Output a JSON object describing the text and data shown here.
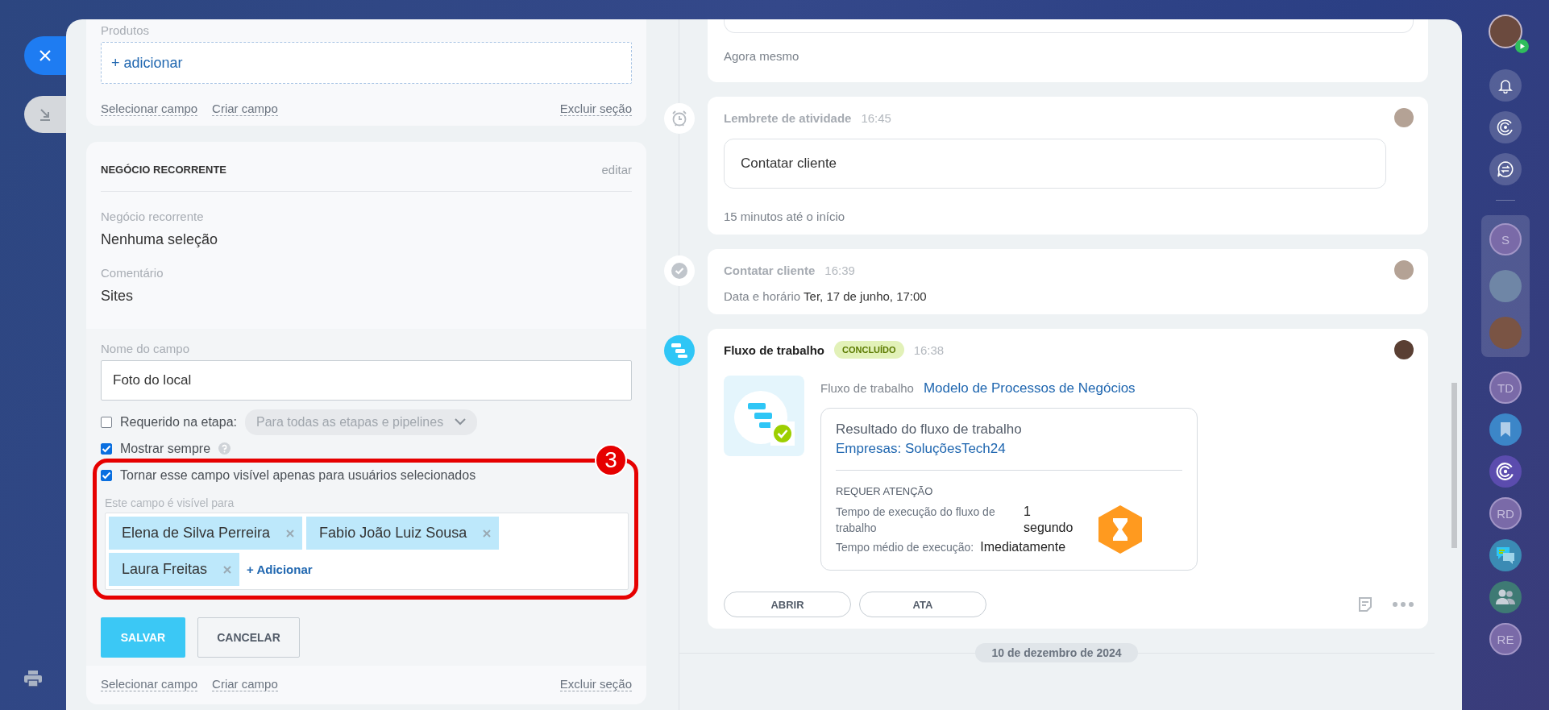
{
  "left_panel": {
    "products_section": {
      "label": "Produtos",
      "add_link": "+ adicionar",
      "links": [
        "Selecionar campo",
        "Criar campo"
      ],
      "delete_link": "Excluir seção"
    },
    "recurring_section": {
      "title": "NEGÓCIO RECORRENTE",
      "edit_link": "editar",
      "fields": [
        {
          "label": "Negócio recorrente",
          "value": "Nenhuma seleção"
        },
        {
          "label": "Comentário",
          "value": "Sites"
        }
      ],
      "editor": {
        "name_label": "Nome do campo",
        "name_value": "Foto do local",
        "options": [
          {
            "kind": "dropdown",
            "label": "Requerido na etapa:",
            "checked": false,
            "dropdown": "Para todas as etapas e pipelines"
          },
          {
            "kind": "help",
            "label": "Mostrar sempre",
            "checked": true
          },
          {
            "kind": "plain",
            "label": "Tornar esse campo visível apenas para usuários selecionados",
            "checked": true
          }
        ],
        "callout": "3",
        "visible_for": {
          "label": "Este campo é visível para",
          "users": [
            "Elena de Silva Perreira",
            "Fabio João Luiz Sousa",
            "Laura Freitas"
          ],
          "add_link": "+ Adicionar"
        },
        "save": "SALVAR",
        "cancel": "CANCELAR"
      },
      "links": [
        "Selecionar campo",
        "Criar campo"
      ],
      "delete_link": "Excluir seção"
    }
  },
  "timeline": {
    "events": [
      {
        "kind": "note",
        "footer": "Agora mesmo"
      },
      {
        "kind": "reminder",
        "title": "Lembrete de atividade",
        "time": "16:45",
        "body": "Contatar cliente",
        "footer": "15 minutos até o início"
      },
      {
        "kind": "done",
        "title": "Contatar cliente",
        "time": "16:39",
        "detail_label": "Data e horário",
        "detail_value": "Ter, 17 de junho, 17:00"
      },
      {
        "kind": "workflow",
        "title": "Fluxo de trabalho",
        "status": "CONCLUÍDO",
        "time": "16:38",
        "link_label": "Fluxo de trabalho",
        "link": "Modelo de Processos de Negócios",
        "result_title": "Resultado do fluxo de trabalho",
        "result_link": "Empresas: SoluçõesTech24",
        "attention": "REQUER ATENÇÃO",
        "stats": [
          {
            "label": "Tempo de execução do fluxo de trabalho",
            "value": "1 segundo"
          },
          {
            "label": "Tempo médio de execução:",
            "value": "Imediatamente"
          }
        ],
        "buttons": [
          "ABRIR",
          "ATA"
        ]
      }
    ],
    "date_divider": "10 de dezembro de 2024"
  },
  "sidebar": {
    "tools": [
      {
        "kind": "bell"
      },
      {
        "kind": "swirl"
      },
      {
        "kind": "swap-chat"
      }
    ],
    "pinned": [
      {
        "kind": "initials",
        "text": "S"
      },
      {
        "kind": "photo"
      },
      {
        "kind": "photo"
      }
    ],
    "items": [
      {
        "kind": "initials",
        "text": "TD"
      },
      {
        "kind": "bookmark"
      },
      {
        "kind": "swirl"
      },
      {
        "kind": "initials",
        "text": "RD"
      },
      {
        "kind": "chat"
      },
      {
        "kind": "people"
      },
      {
        "kind": "initials",
        "text": "RE"
      }
    ]
  }
}
